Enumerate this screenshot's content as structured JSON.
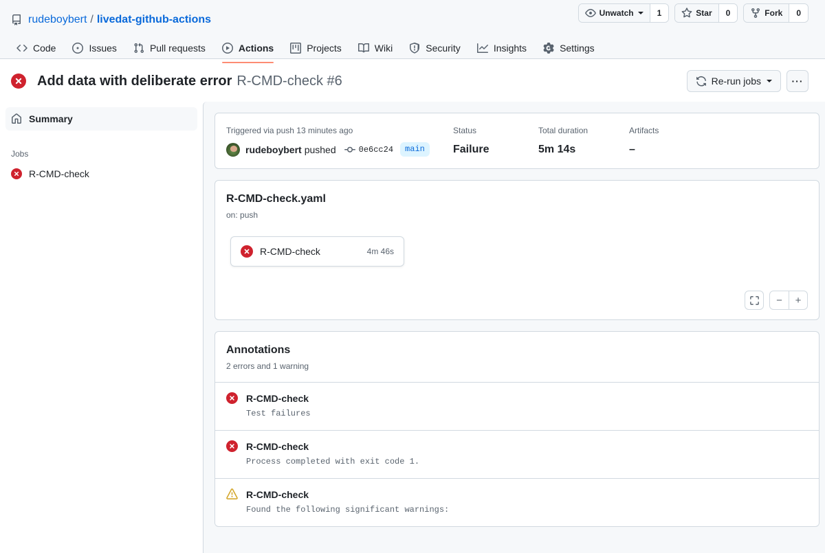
{
  "repo": {
    "owner": "rudeboybert",
    "name": "livedat-github-actions",
    "separator": "/",
    "actions": [
      {
        "icon": "eye-icon",
        "label": "Unwatch",
        "has_caret": true,
        "count": "1"
      },
      {
        "icon": "star-icon",
        "label": "Star",
        "has_caret": false,
        "count": "0"
      },
      {
        "icon": "fork-icon",
        "label": "Fork",
        "has_caret": false,
        "count": "0"
      }
    ]
  },
  "nav": {
    "items": [
      {
        "label": "Code",
        "icon": "code-icon",
        "selected": false
      },
      {
        "label": "Issues",
        "icon": "issue-icon",
        "selected": false
      },
      {
        "label": "Pull requests",
        "icon": "pr-icon",
        "selected": false
      },
      {
        "label": "Actions",
        "icon": "play-icon",
        "selected": true
      },
      {
        "label": "Projects",
        "icon": "project-icon",
        "selected": false
      },
      {
        "label": "Wiki",
        "icon": "book-icon",
        "selected": false
      },
      {
        "label": "Security",
        "icon": "shield-icon",
        "selected": false
      },
      {
        "label": "Insights",
        "icon": "graph-icon",
        "selected": false
      },
      {
        "label": "Settings",
        "icon": "gear-icon",
        "selected": false
      }
    ],
    "selected_underline_color": "#fd8c73"
  },
  "run": {
    "status_icon": "error-x-icon",
    "title": "Add data with deliberate error",
    "subtitle": "R-CMD-check #6",
    "rerun_label": "Re-run jobs",
    "rerun_icon": "sync-icon",
    "more_label": "···"
  },
  "sidebar": {
    "summary": {
      "label": "Summary",
      "icon": "home-icon",
      "selected": true
    },
    "jobs_heading": "Jobs",
    "jobs": [
      {
        "label": "R-CMD-check",
        "icon": "error-x-icon"
      }
    ]
  },
  "summary": {
    "trigger_label": "Triggered via push 13 minutes ago",
    "actor": "rudeboybert",
    "action_word": "pushed",
    "commit_sha": "0e6cc24",
    "branch": "main",
    "status_label": "Status",
    "status_value": "Failure",
    "duration_label": "Total duration",
    "duration_value": "5m 14s",
    "artifacts_label": "Artifacts",
    "artifacts_value": "–"
  },
  "workflow": {
    "file": "R-CMD-check.yaml",
    "trigger": "on: push",
    "node": {
      "name": "R-CMD-check",
      "duration": "4m 46s",
      "icon": "error-x-icon"
    },
    "controls": {
      "fullscreen": "fullscreen-icon",
      "zoom_out": "−",
      "zoom_in": "+"
    }
  },
  "annotations": {
    "title": "Annotations",
    "summary": "2 errors and 1 warning",
    "items": [
      {
        "severity": "error",
        "name": "R-CMD-check",
        "message": "Test failures"
      },
      {
        "severity": "error",
        "name": "R-CMD-check",
        "message": "Process completed with exit code 1."
      },
      {
        "severity": "warning",
        "name": "R-CMD-check",
        "message": "Found the following significant warnings:"
      }
    ]
  },
  "colors": {
    "accent": "#0969da",
    "danger": "#cf222e",
    "warning": "#d4a72c",
    "tab_underline": "#fd8c73",
    "canvas_subtle": "#f6f8fa",
    "border": "#d1d9e0"
  }
}
